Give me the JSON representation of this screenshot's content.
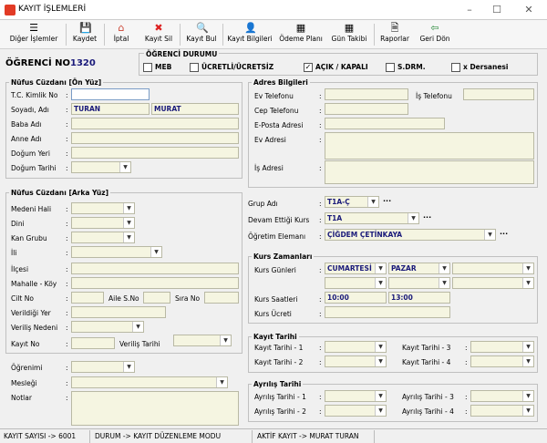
{
  "window": {
    "title": "KAYIT İŞLEMLERİ",
    "minimize": "–",
    "maximize": "☐",
    "close": "✕"
  },
  "toolbar": [
    {
      "label": "Diğer İşlemler",
      "icon": "menu-icon",
      "glyph": "☰"
    },
    {
      "label": "Kaydet",
      "icon": "save-icon",
      "glyph": "💾"
    },
    {
      "label": "İptal",
      "icon": "cancel-home-icon",
      "glyph": "⌂"
    },
    {
      "label": "Kayıt Sil",
      "icon": "delete-icon",
      "glyph": "✖"
    },
    {
      "label": "Kayıt Bul",
      "icon": "find-icon",
      "glyph": "🔍"
    },
    {
      "label": "Kayıt Bilgileri",
      "icon": "record-info-icon",
      "glyph": "👤"
    },
    {
      "label": "Ödeme Planı",
      "icon": "payment-plan-icon",
      "glyph": "▦"
    },
    {
      "label": "Gün Takibi",
      "icon": "calendar-icon",
      "glyph": "▦"
    },
    {
      "label": "Raporlar",
      "icon": "report-icon",
      "glyph": "🗎"
    },
    {
      "label": "Geri Dön",
      "icon": "back-arrow-icon",
      "glyph": "⇦"
    }
  ],
  "student": {
    "label": "ÖĞRENCİ NO",
    "number": "1320"
  },
  "status_group": {
    "title": "ÖĞRENCİ DURUMU",
    "items": [
      {
        "label": "MEB",
        "checked": false
      },
      {
        "label": "ÜCRETLİ/ÜCRETSİZ",
        "checked": false
      },
      {
        "label": "AÇIK / KAPALI",
        "checked": true
      },
      {
        "label": "S.DRM.",
        "checked": false
      },
      {
        "label": "x Dersanesi",
        "checked": false
      }
    ],
    "check_mark": "✓"
  },
  "nufus_on": {
    "title": "Nüfus Cüzdanı [Ön Yüz]",
    "tc": "T.C. Kimlik No",
    "soyadi": "Soyadı, Adı",
    "soyadi_value": "TURAN",
    "adi_value": "MURAT",
    "baba": "Baba Adı",
    "anne": "Anne Adı",
    "dogum_yeri": "Doğum Yeri",
    "dogum_tarihi": "Doğum Tarihi"
  },
  "nufus_arka": {
    "title": "Nüfus Cüzdanı [Arka Yüz]",
    "medeni": "Medeni Hali",
    "dini": "Dini",
    "kan": "Kan Grubu",
    "il": "İli",
    "ilce": "İlçesi",
    "mahalle": "Mahalle - Köy",
    "cilt": "Cilt No",
    "aile": "Aile S.No",
    "sira": "Sıra No",
    "verildigi": "Verildiği Yer",
    "verilis_nedeni": "Veriliş Nedeni",
    "kayit_no": "Kayıt No",
    "verilis_tarihi": "Veriliş Tarihi"
  },
  "bottom_left": {
    "ogrenimi": "Öğrenimi",
    "meslegi": "Mesleği",
    "notlar": "Notlar"
  },
  "adres": {
    "title": "Adres Bilgileri",
    "ev_tel": "Ev Telefonu",
    "is_tel": "İş Telefonu",
    "cep": "Cep Telefonu",
    "eposta": "E-Posta Adresi",
    "ev_adres": "Ev Adresi",
    "is_adres": "İş Adresi"
  },
  "grup": {
    "grup_adi": "Grup Adı",
    "grup_value": "T1A-Ç",
    "devam": "Devam Ettiği Kurs",
    "devam_value": "T1A",
    "ogretim": "Öğretim Elemanı",
    "ogretim_value": "ÇİĞDEM ÇETİNKAYA",
    "dots": "..."
  },
  "kurs": {
    "title": "Kurs Zamanları",
    "gunler": "Kurs Günleri",
    "gun1": "CUMARTESİ",
    "gun2": "PAZAR",
    "saatler": "Kurs Saatleri",
    "saat1": "10:00",
    "saat2": "13:00",
    "ucret": "Kurs Ücreti"
  },
  "kayit_tarihi": {
    "title": "Kayıt Tarihi",
    "t1": "Kayıt Tarihi - 1",
    "t2": "Kayıt Tarihi - 2",
    "t3": "Kayıt Tarihi - 3",
    "t4": "Kayıt Tarihi - 4"
  },
  "ayrilis": {
    "title": "Ayrılış Tarihi",
    "t1": "Ayrılış Tarihi - 1",
    "t2": "Ayrılış Tarihi - 2",
    "t3": "Ayrılış Tarihi - 3",
    "t4": "Ayrılış Tarihi - 4"
  },
  "statusbar": {
    "s1": "KAYIT SAYISI -> 6001",
    "s2": "DURUM -> KAYIT DÜZENLEME MODU",
    "s3": "AKTİF KAYIT -> MURAT TURAN"
  },
  "colors": {
    "accent": "#1a1a7a",
    "field": "#f5f5e1"
  }
}
